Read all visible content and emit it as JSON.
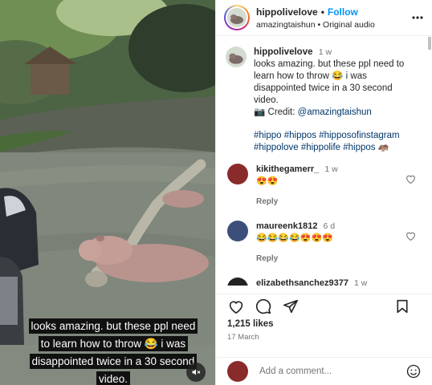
{
  "video": {
    "caption": "looks amazing. but these ppl need to learn how to throw 😂 i was disappointed twice in a 30 second video."
  },
  "header": {
    "username": "hippolivelove",
    "follow_label": "Follow",
    "separator": "•",
    "subtitle": "amazingtaishun • Original audio"
  },
  "post": {
    "username": "hippolivelove",
    "time": "1 w",
    "text": "looks amazing. but these ppl need to learn how to throw 😂 i was disappointed twice in a 30 second video.",
    "credit_prefix": "📷 Credit: ",
    "credit_link": "@amazingtaishun",
    "hashtags": "#hippo #hippos #hipposofinstagram #hippolove #hippolife #hippos 🦛"
  },
  "comments": [
    {
      "username": "kikithegamerr_",
      "time": "1 w",
      "text": "😍😍",
      "reply": "Reply",
      "avatar_color": "#8a2b2b"
    },
    {
      "username": "maureenk1812",
      "time": "6 d",
      "text": "😂😂😂😂😍😍😍",
      "reply": "Reply",
      "avatar_color": "#3c4f7a"
    },
    {
      "username": "elizabethsanchez9377",
      "time": "1 w",
      "text": "",
      "reply": "",
      "avatar_color": "#222222"
    }
  ],
  "footer": {
    "likes": "1,215 likes",
    "date": "17 March",
    "comment_placeholder": "Add a comment..."
  },
  "colors": {
    "link": "#00376b",
    "follow": "#0095f6",
    "muted": "#737373"
  }
}
